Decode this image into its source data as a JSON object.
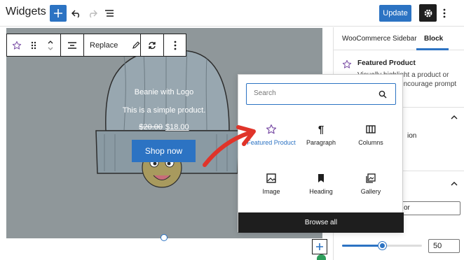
{
  "header": {
    "title": "Widgets",
    "update_label": "Update"
  },
  "block_toolbar": {
    "replace_label": "Replace"
  },
  "product": {
    "title": "Beanie with Logo",
    "description": "This is a simple product.",
    "price_old": "$20.00",
    "price_new": "$18.00",
    "button_label": "Shop now"
  },
  "sidebar": {
    "tabs": [
      {
        "label": "WooCommerce Sidebar",
        "active": false
      },
      {
        "label": "Block",
        "active": true
      }
    ],
    "block_title": "Featured Product",
    "block_desc_partial": "Visually highlight a product or variation and encourage prompt",
    "partial_text_1": "ion",
    "partial_text_2": "or",
    "number_value": "50",
    "slider_fraction": 0.5
  },
  "inserter": {
    "search_placeholder": "Search",
    "blocks": [
      {
        "label": "Featured Product",
        "icon": "star-icon",
        "active": true
      },
      {
        "label": "Paragraph",
        "icon": "paragraph-icon",
        "active": false
      },
      {
        "label": "Columns",
        "icon": "columns-icon",
        "active": false
      },
      {
        "label": "Image",
        "icon": "image-icon",
        "active": false
      },
      {
        "label": "Heading",
        "icon": "bookmark-icon",
        "active": false
      },
      {
        "label": "Gallery",
        "icon": "gallery-icon",
        "active": false
      }
    ],
    "browse_all_label": "Browse all"
  },
  "colors": {
    "accent": "#2c73c3",
    "dark": "#1e1e1e",
    "star_purple": "#7b4fa6",
    "arrow_red": "#e0342a"
  }
}
